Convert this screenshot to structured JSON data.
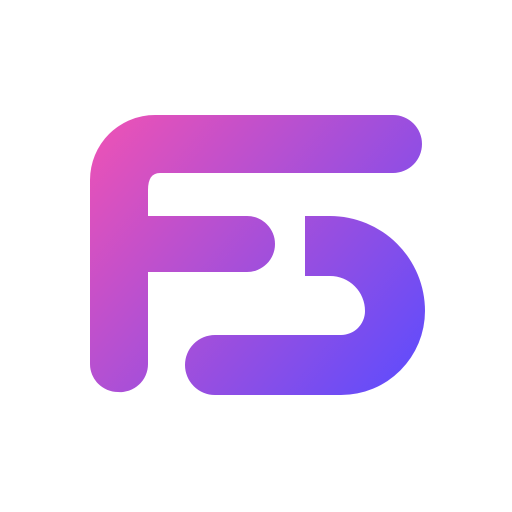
{
  "logo": {
    "name": "fs-monogram-logo",
    "gradient_start": "#f052b4",
    "gradient_end": "#5a4cff",
    "background": "#ffffff"
  }
}
